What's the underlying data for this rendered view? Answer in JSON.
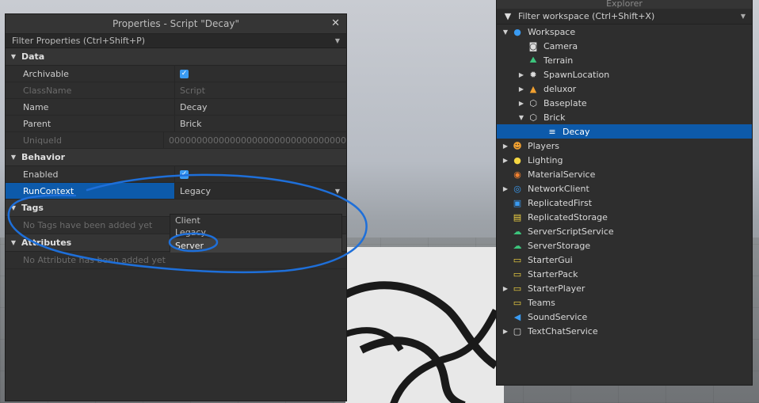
{
  "properties": {
    "title": "Properties - Script \"Decay\"",
    "close": "✕",
    "filter_placeholder": "Filter Properties (Ctrl+Shift+P)",
    "sections": {
      "data": "Data",
      "behavior": "Behavior",
      "tags": "Tags",
      "attributes": "Attributes"
    },
    "data_rows": [
      {
        "name": "Archivable",
        "value": "✓"
      },
      {
        "name": "ClassName",
        "value": "Script"
      },
      {
        "name": "Name",
        "value": "Decay"
      },
      {
        "name": "Parent",
        "value": "Brick"
      },
      {
        "name": "UniqueId",
        "value": "00000000000000000000000000000000"
      }
    ],
    "behavior_rows": [
      {
        "name": "Enabled",
        "value": "✓"
      },
      {
        "name": "RunContext",
        "value": "Legacy"
      }
    ],
    "runcontext_options": [
      "Client",
      "Legacy",
      "Server"
    ],
    "tags_empty": "No Tags have been added yet",
    "attributes_plus": "+",
    "attributes_empty": "No Attribute has been added yet"
  },
  "explorer": {
    "title": "Explorer",
    "filter_placeholder": "Filter workspace (Ctrl+Shift+X)",
    "items": [
      {
        "label": "Workspace",
        "icon": "globe-icon"
      },
      {
        "label": "Camera",
        "icon": "camera-icon"
      },
      {
        "label": "Terrain",
        "icon": "terrain-icon"
      },
      {
        "label": "SpawnLocation",
        "icon": "spawn-icon"
      },
      {
        "label": "deluxor",
        "icon": "model-icon"
      },
      {
        "label": "Baseplate",
        "icon": "part-icon"
      },
      {
        "label": "Brick",
        "icon": "part-icon"
      },
      {
        "label": "Decay",
        "icon": "script-icon"
      },
      {
        "label": "Players",
        "icon": "players-icon"
      },
      {
        "label": "Lighting",
        "icon": "lightbulb-icon"
      },
      {
        "label": "MaterialService",
        "icon": "material-icon"
      },
      {
        "label": "NetworkClient",
        "icon": "network-icon"
      },
      {
        "label": "ReplicatedFirst",
        "icon": "replicated-first-icon"
      },
      {
        "label": "ReplicatedStorage",
        "icon": "replicated-storage-icon"
      },
      {
        "label": "ServerScriptService",
        "icon": "server-script-icon"
      },
      {
        "label": "ServerStorage",
        "icon": "server-storage-icon"
      },
      {
        "label": "StarterGui",
        "icon": "starter-gui-icon"
      },
      {
        "label": "StarterPack",
        "icon": "starter-pack-icon"
      },
      {
        "label": "StarterPlayer",
        "icon": "starter-player-icon"
      },
      {
        "label": "Teams",
        "icon": "teams-icon"
      },
      {
        "label": "SoundService",
        "icon": "sound-icon"
      },
      {
        "label": "TextChatService",
        "icon": "chat-icon"
      }
    ]
  },
  "colors": {
    "selection": "#0d5aaa",
    "checkbox": "#3a9bf2",
    "annotation": "#1e6fd9"
  }
}
